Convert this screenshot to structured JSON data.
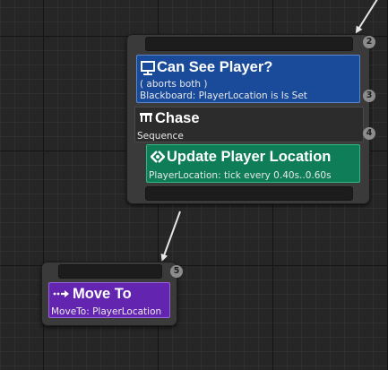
{
  "nodes": {
    "selector": {
      "badge": "2",
      "decorator": {
        "title": "Can See Player?",
        "subtitle": "( aborts both )",
        "detail": "Blackboard: PlayerLocation is Is Set",
        "badge": "3",
        "icon": "eye-monitor-icon",
        "color": "#1a4b9a"
      },
      "composite": {
        "title": "Chase",
        "subtitle": "Sequence",
        "badge": "4",
        "icon": "sequence-icon",
        "color": "#2c2c2c"
      },
      "service": {
        "title": "Update Player Location",
        "detail": "PlayerLocation: tick every 0.40s..0.60s",
        "icon": "service-icon",
        "color": "#0f7d57"
      }
    },
    "task": {
      "title": "Move To",
      "detail": "MoveTo: PlayerLocation",
      "badge": "5",
      "icon": "move-arrow-icon",
      "color": "#6325b0"
    }
  }
}
